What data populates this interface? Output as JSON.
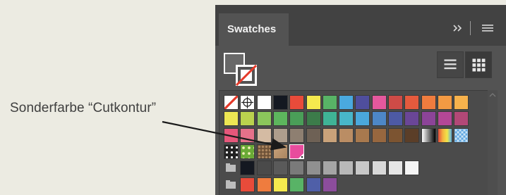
{
  "annotation": {
    "label": "Sonderfarbe “Cutkontur”"
  },
  "panel": {
    "tab_label": "Swatches",
    "collapse_label": "››"
  },
  "colors": {
    "page_background": "#ecebe2",
    "panel_background": "#535353",
    "tab_bar": "#424242",
    "cutkontur_spot": "#e84c9d"
  },
  "swatch_rows": [
    [
      "none",
      "registration",
      "#ffffff",
      "#141821",
      "#e84b3a",
      "#f5e94e",
      "#58b366",
      "#4aa9df",
      "#4f4e9d",
      "#e4589d",
      "#ce4b47",
      "#e55a3d",
      "#ef7c3e",
      "#f39a43",
      "#f7b24c"
    ],
    [
      "#ede653",
      "#bad24e",
      "#8bc65b",
      "#5db65d",
      "#4a9e58",
      "#3c7c4a",
      "#3fb396",
      "#48b6c9",
      "#4aa8dc",
      "#4d87c7",
      "#4d5aa5",
      "#6a4697",
      "#8c4498",
      "#b34796",
      "#b24877"
    ],
    [
      "#e6577b",
      "#e5718a",
      "#d4bba3",
      "#ae9e8d",
      "#8e7f71",
      "#6e6155",
      "#c9a27a",
      "#ba8d64",
      "#a8794e",
      "#97673f",
      "#7c5431",
      "#5b3e28",
      "gradient-bw",
      "gradient-rainbow",
      "pattern-check"
    ],
    [
      "pattern-dots",
      "pattern-leaf",
      "pattern-stone",
      "pattern-tan",
      "spot-cutkontur"
    ],
    [
      "folder",
      "#141821",
      "#4a4a4a",
      "#5a5a5a",
      "#7a7a7a",
      "#909090",
      "#a5a5a5",
      "#b8b8b8",
      "#c8c8c8",
      "#d8d8d8",
      "#e6e6e6",
      "#f5f5f5"
    ],
    [
      "folder",
      "#e84b3a",
      "#ef7c3e",
      "#f5e94e",
      "#58b366",
      "#4f5fa8",
      "#8c4d9c"
    ]
  ]
}
